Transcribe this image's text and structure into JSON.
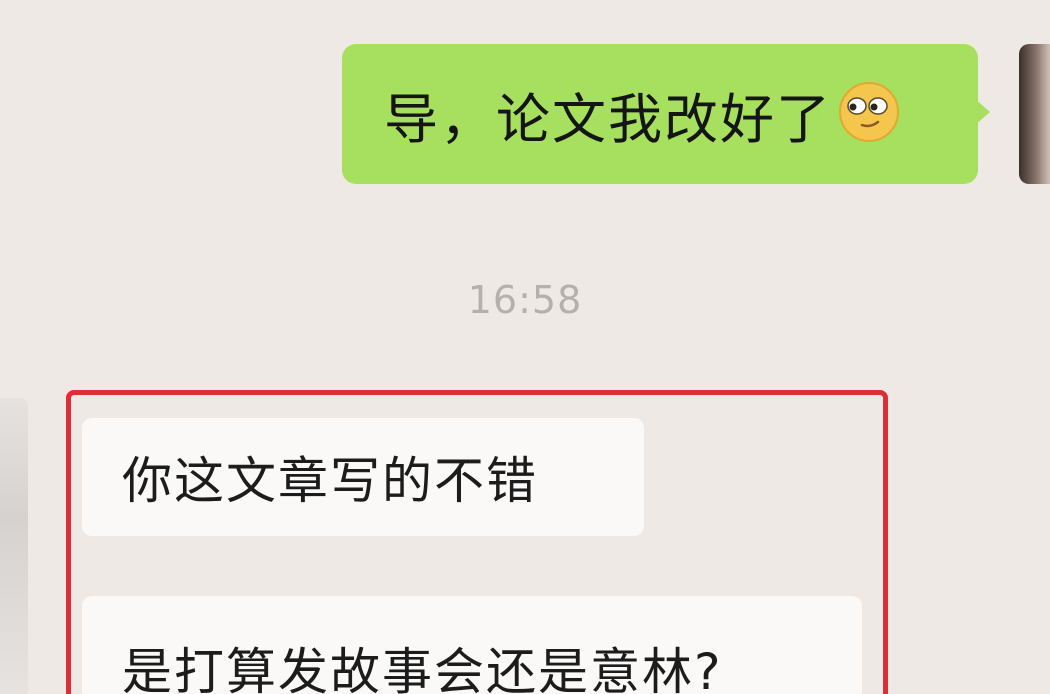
{
  "conversation": {
    "outgoing_message": {
      "text": "导，论文我改好了",
      "emoji_icon": "smirk-face-emoji"
    },
    "timestamp": "16:58",
    "incoming_messages": [
      {
        "text": "你这文章写的不错"
      },
      {
        "text": "是打算发故事会还是意林?"
      }
    ]
  },
  "colors": {
    "background": "#efe9e6",
    "outgoing_bubble": "#a7e05f",
    "incoming_bubble": "#faf9f8",
    "highlight_border": "#dc2e35",
    "timestamp_text": "#b4b0ad"
  }
}
